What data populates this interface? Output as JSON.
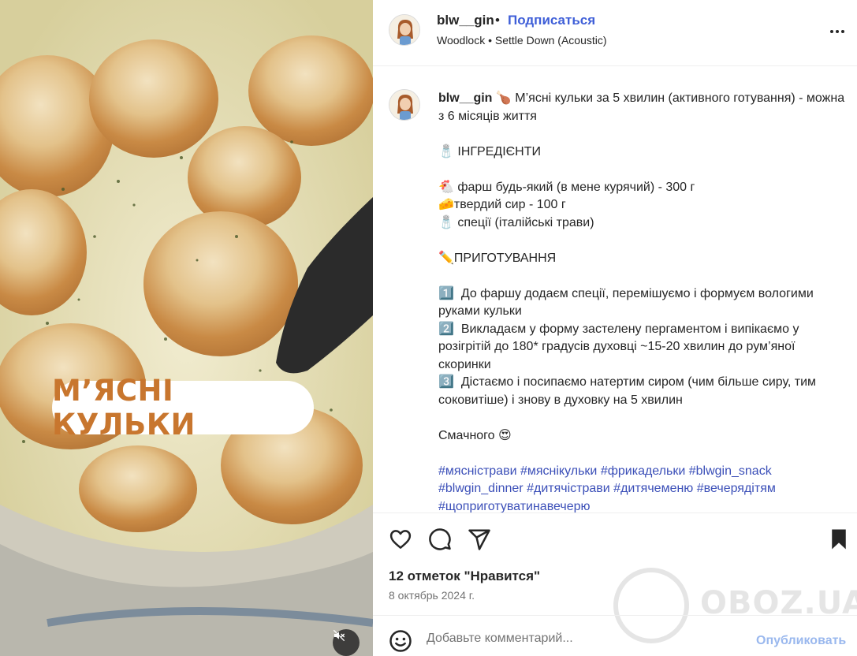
{
  "post": {
    "username": "blw__gin",
    "separator": "•",
    "follow_label": "Подписаться",
    "music": {
      "artist": "Woodlock",
      "separator": "•",
      "track": "Settle Down (Acoustic)"
    },
    "overlay_text": "М’ЯСНІ КУЛЬКИ"
  },
  "caption": {
    "username": "blw__gin",
    "title": "🍗 М’ясні кульки за 5 хвилин (активного готування) - можна з 6 місяців життя",
    "ingredients_heading": "🧂 ІНГРЕДІЄНТИ",
    "ingredients": [
      "🐔 фарш будь-який (в мене курячий) - 300 г",
      "🧀твердий сир - 100 г",
      "🧂 спеції (італійські трави)"
    ],
    "method_heading": "✏️ПРИГОТУВАННЯ",
    "steps": [
      "1️⃣  До фаршу додаєм спеції, перемішуємо і формуєм вологими руками кульки",
      "2️⃣  Викладаєм у форму застелену пергаментом і випікаємо у розігрітій до 180* градусів духовці ~15-20 хвилин до рум’яної скоринки",
      "3️⃣  Дістаємо і посипаємо натертим сиром (чим більше сиру, тим соковитіше) і знову в духовку на 5 хвилин"
    ],
    "closing": "Смачного 😍",
    "hashtags": [
      "#мясністрави",
      "#мяснікульки",
      "#фрикадельки",
      "#blwgin_snack",
      "#blwgin_dinner",
      "#дитячістрави",
      "#дитячеменю",
      "#вечерядітям",
      "#щоприготуватинавечерю"
    ]
  },
  "engagement": {
    "likes_text": "12 отметок \"Нравится\"",
    "date": "8 октябрь 2024 г."
  },
  "comment": {
    "placeholder": "Добавьте комментарий...",
    "post_label": "Опубликовать"
  },
  "watermark": {
    "text": "OBOZ.UA"
  },
  "icons": {
    "like": "heart-icon",
    "comment": "speech-bubble-icon",
    "share": "paper-plane-icon",
    "save": "bookmark-icon",
    "more": "more-horizontal-icon",
    "emoji": "smiley-icon",
    "mute": "muted-speaker-icon"
  },
  "colors": {
    "link_blue": "#3f5fd8",
    "hashtag_blue": "#3b4fb8",
    "post_button_disabled": "#9ab8ee",
    "overlay_text": "#c8762e"
  }
}
